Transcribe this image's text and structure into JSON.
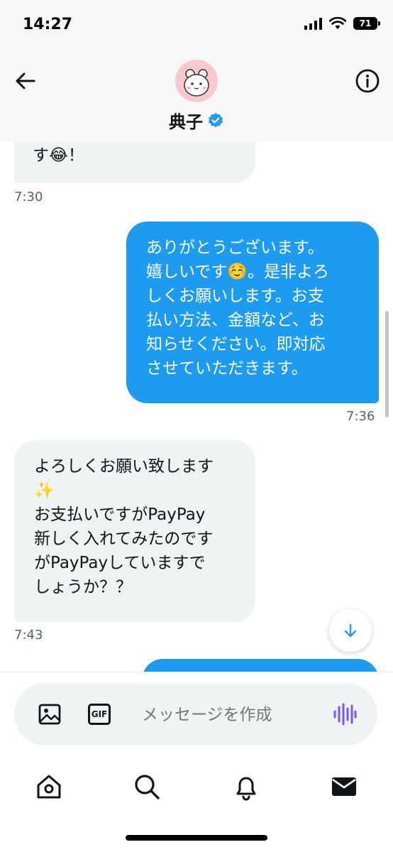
{
  "status_bar": {
    "time": "14:27",
    "battery": "71"
  },
  "header": {
    "contact_name": "典子",
    "verified": true
  },
  "messages": [
    {
      "direction": "in",
      "lines": [
        "す😂！"
      ],
      "time": "7:30"
    },
    {
      "direction": "out",
      "lines": [
        "ありがとうございます。",
        "嬉しいです☺️。是非よろ",
        "しくお願いします。お支",
        "払い方法、金額など、お",
        "知らせください。即対応",
        "させていただきます。"
      ],
      "time": "7:36"
    },
    {
      "direction": "in",
      "lines": [
        "よろしくお願い致します",
        "✨",
        "お支払いですがPayPay",
        "新しく入れてみたのです",
        "がPayPayしていますで",
        "しょうか？？"
      ],
      "time": "7:43"
    }
  ],
  "composer": {
    "placeholder": "メッセージを作成",
    "gif_label": "GIF"
  },
  "icons": {
    "back": "arrow-left-icon",
    "info": "info-icon",
    "image": "image-icon",
    "gif": "gif-icon",
    "voice": "voice-waveform-icon",
    "scroll_down": "arrow-down-icon",
    "tabs": [
      "home-icon",
      "search-icon",
      "bell-icon",
      "mail-icon"
    ]
  },
  "colors": {
    "accent": "#1d9bf0",
    "voice": "#7856ff",
    "incoming_bubble": "#eff3f4",
    "outgoing_bubble": "#1d9bf0"
  }
}
